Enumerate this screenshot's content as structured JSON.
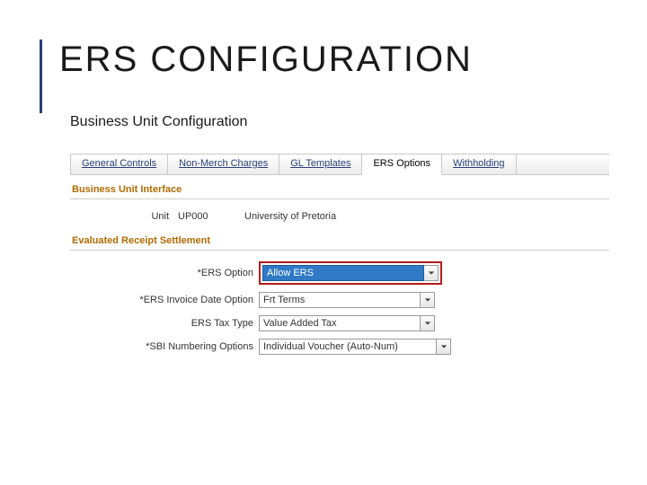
{
  "slide": {
    "title": "ERS CONFIGURATION",
    "subtitle": "Business Unit Configuration"
  },
  "tabs": {
    "items": [
      {
        "label": "General Controls"
      },
      {
        "label": "Non-Merch Charges"
      },
      {
        "label": "GL Templates"
      },
      {
        "label": "ERS Options"
      },
      {
        "label": "Withholding"
      }
    ],
    "active_index": 3
  },
  "sections": {
    "bui": {
      "heading": "Business Unit Interface",
      "unit_label": "Unit",
      "unit_value": "UP000",
      "unit_name": "University of Pretoria"
    },
    "ers": {
      "heading": "Evaluated Receipt Settlement",
      "fields": {
        "ers_option_label": "*ERS Option",
        "ers_option_value": "Allow ERS",
        "inv_date_label": "*ERS Invoice Date Option",
        "inv_date_value": "Frt Terms",
        "tax_type_label": "ERS Tax Type",
        "tax_type_value": "Value Added Tax",
        "sbi_label": "*SBI Numbering Options",
        "sbi_value": "Individual Voucher (Auto-Num)"
      }
    }
  }
}
